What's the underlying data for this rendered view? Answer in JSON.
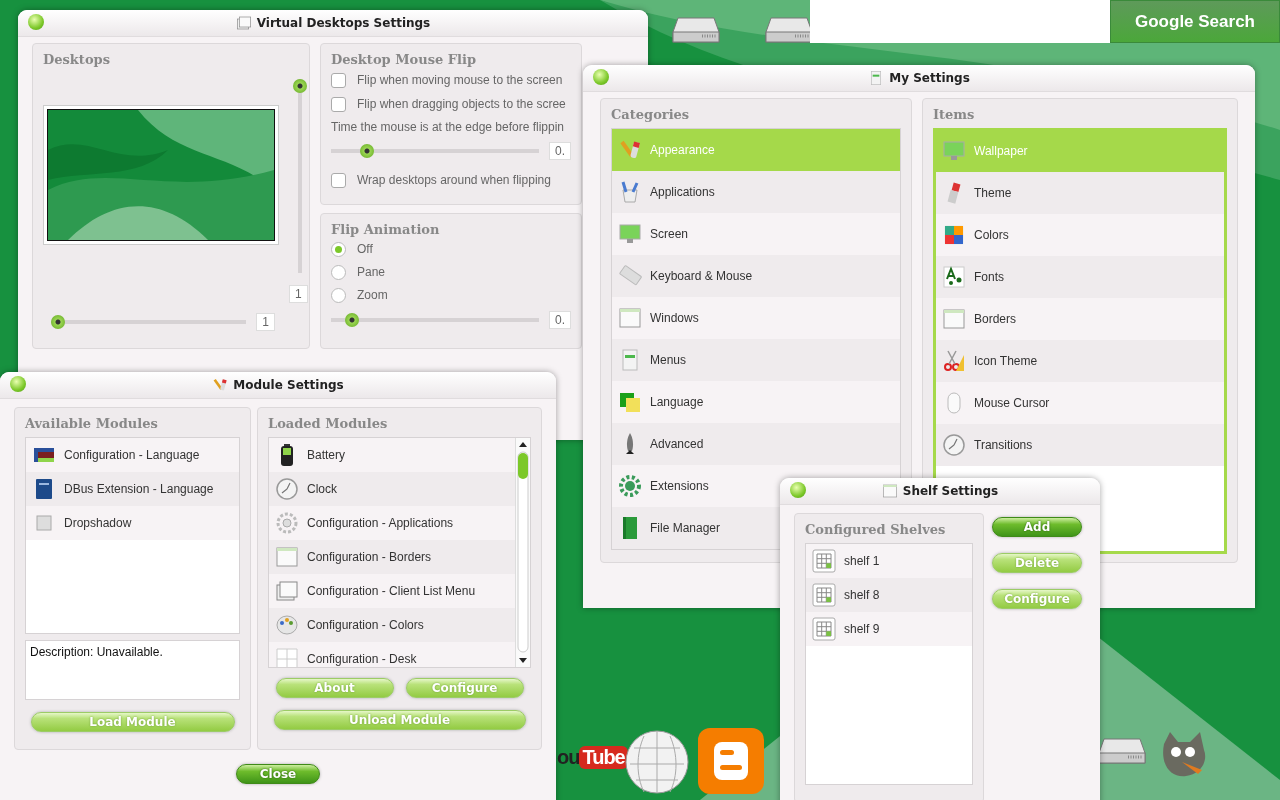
{
  "search": {
    "button": "Google Search"
  },
  "youtube_logo": {
    "part_1": "ou",
    "part_2": "Tube"
  },
  "virtual_desktops": {
    "title": "Virtual Desktops Settings",
    "desktops": {
      "heading": "Desktops",
      "rows_slider": {
        "level": 1
      },
      "rows_value": "1",
      "columns_slider": {
        "level": 0
      },
      "columns_value": "1"
    },
    "mouse_flip": {
      "heading": "Desktop Mouse Flip",
      "options": [
        {
          "label": "Flip when moving mouse to the screen",
          "checked": false
        },
        {
          "label": "Flip when dragging objects to the scree",
          "checked": false
        }
      ],
      "time_label": "Time the mouse is at the edge before flippin",
      "time_slider": {
        "level": 0.15
      },
      "time_value": "0.",
      "wrap": {
        "label": "Wrap desktops around when flipping",
        "checked": false
      }
    },
    "flip_animation": {
      "heading": "Flip Animation",
      "options": [
        {
          "label": "Off",
          "selected": true
        },
        {
          "label": "Pane",
          "selected": false
        },
        {
          "label": "Zoom",
          "selected": false
        }
      ],
      "slider": {
        "level": 0.07
      },
      "value": "0."
    }
  },
  "module_settings": {
    "title": "Module Settings",
    "available": {
      "heading": "Available Modules",
      "items": [
        {
          "label": "Configuration - Language"
        },
        {
          "label": "DBus Extension - Language"
        },
        {
          "label": "Dropshadow"
        }
      ],
      "description": "Description: Unavailable.",
      "button": {
        "label": "Load Module",
        "primary": false
      }
    },
    "loaded": {
      "heading": "Loaded Modules",
      "items": [
        {
          "label": "Battery"
        },
        {
          "label": "Clock"
        },
        {
          "label": "Configuration - Applications"
        },
        {
          "label": "Configuration - Borders"
        },
        {
          "label": "Configuration - Client List Menu"
        },
        {
          "label": "Configuration - Colors"
        },
        {
          "label": "Configuration - Desk"
        }
      ],
      "buttons": [
        {
          "label": "About",
          "primary": false
        },
        {
          "label": "Configure",
          "primary": false
        }
      ],
      "unload_button": {
        "label": "Unload Module",
        "primary": false
      }
    },
    "close_button": {
      "label": "Close",
      "primary": true
    }
  },
  "my_settings": {
    "title": "My Settings",
    "categories": {
      "heading": "Categories",
      "items": [
        {
          "label": "Appearance",
          "selected": true
        },
        {
          "label": "Applications",
          "selected": false
        },
        {
          "label": "Screen",
          "selected": false
        },
        {
          "label": "Keyboard & Mouse",
          "selected": false
        },
        {
          "label": "Windows",
          "selected": false
        },
        {
          "label": "Menus",
          "selected": false
        },
        {
          "label": "Language",
          "selected": false
        },
        {
          "label": "Advanced",
          "selected": false
        },
        {
          "label": "Extensions",
          "selected": false
        },
        {
          "label": "File Manager",
          "selected": false
        }
      ]
    },
    "items": {
      "heading": "Items",
      "items": [
        {
          "label": "Wallpaper",
          "selected": true
        },
        {
          "label": "Theme",
          "selected": false
        },
        {
          "label": "Colors",
          "selected": false
        },
        {
          "label": "Fonts",
          "selected": false
        },
        {
          "label": "Borders",
          "selected": false
        },
        {
          "label": "Icon Theme",
          "selected": false
        },
        {
          "label": "Mouse Cursor",
          "selected": false
        },
        {
          "label": "Transitions",
          "selected": false
        }
      ]
    }
  },
  "shelf_settings": {
    "title": "Shelf Settings",
    "heading": "Configured Shelves",
    "shelves": [
      {
        "label": "shelf 1"
      },
      {
        "label": "shelf 8"
      },
      {
        "label": "shelf 9"
      }
    ],
    "buttons": [
      {
        "label": "Add",
        "primary": true
      },
      {
        "label": "Delete",
        "primary": false
      },
      {
        "label": "Configure",
        "primary": false
      }
    ]
  }
}
